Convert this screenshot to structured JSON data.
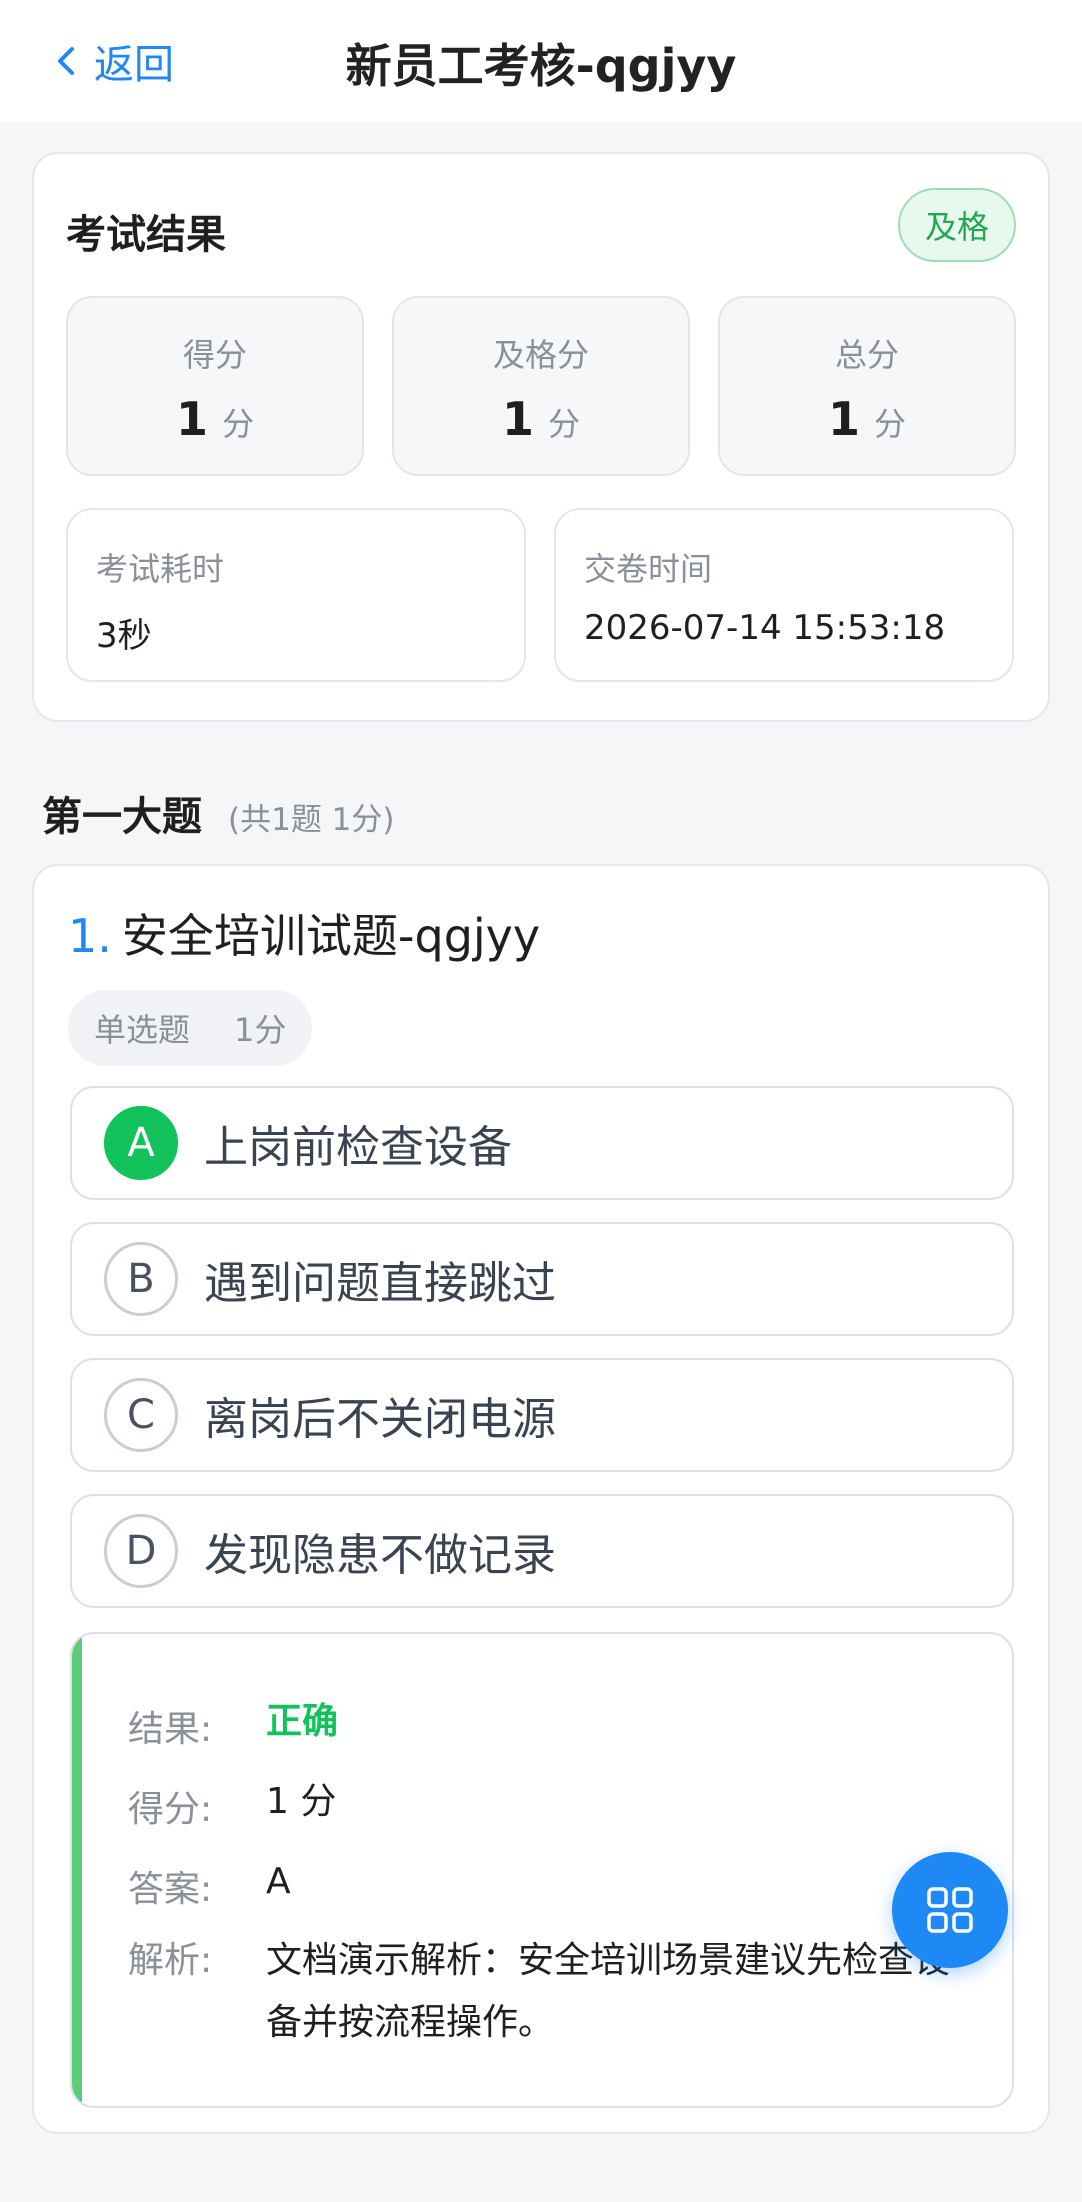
{
  "header": {
    "back_label": "返回",
    "title": "新员工考核-qgjyy"
  },
  "result": {
    "title": "考试结果",
    "status_badge": "及格",
    "score": {
      "label": "得分",
      "value": "1",
      "unit": "分"
    },
    "pass_score": {
      "label": "及格分",
      "value": "1",
      "unit": "分"
    },
    "total_score": {
      "label": "总分",
      "value": "1",
      "unit": "分"
    },
    "duration": {
      "label": "考试耗时",
      "value": "3秒"
    },
    "submit_time": {
      "label": "交卷时间",
      "value": "2026-07-14 15:53:18"
    }
  },
  "section": {
    "title": "第一大题",
    "subtitle": "(共1题 1分)"
  },
  "question": {
    "number": "1.",
    "title": "安全培训试题-qgjyy",
    "type": "单选题",
    "points": "1分",
    "options": [
      {
        "letter": "A",
        "text": "上岗前检查设备",
        "correct": true
      },
      {
        "letter": "B",
        "text": "遇到问题直接跳过",
        "correct": false
      },
      {
        "letter": "C",
        "text": "离岗后不关闭电源",
        "correct": false
      },
      {
        "letter": "D",
        "text": "发现隐患不做记录",
        "correct": false
      }
    ],
    "analysis": {
      "result_label": "结果:",
      "result_value": "正确",
      "score_label": "得分:",
      "score_value": "1 分",
      "answer_label": "答案:",
      "answer_value": "A",
      "explain_label": "解析:",
      "explain_value": "文档演示解析：安全培训场景建议先检查设备并按流程操作。"
    }
  },
  "fab": {
    "icon": "grid-icon"
  },
  "colors": {
    "accent": "#1e88f5",
    "pass": "#12c25a",
    "pass_bar": "#5ccc78"
  }
}
